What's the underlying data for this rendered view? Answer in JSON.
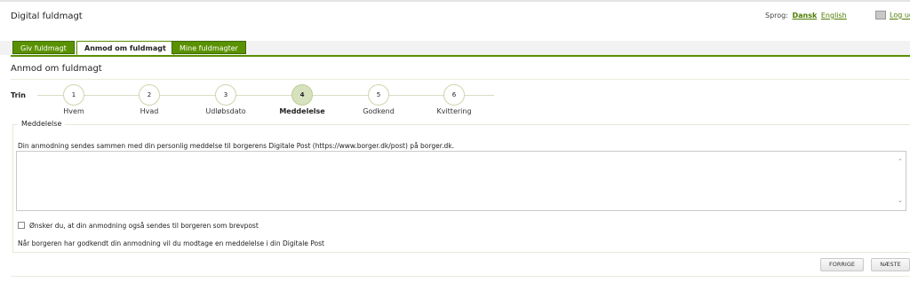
{
  "header": {
    "app_title": "Digital fuldmagt",
    "language_label": "Sprog:",
    "lang_da": "Dansk",
    "lang_en": "English",
    "logout": "Log ud"
  },
  "tabs": [
    {
      "label": "Giv fuldmagt",
      "active": false
    },
    {
      "label": "Anmod om fuldmagt",
      "active": true
    },
    {
      "label": "Mine fuldmagter",
      "active": false
    }
  ],
  "section_title": "Anmod om fuldmagt",
  "wizard": {
    "label": "Trin",
    "current": 4,
    "steps": [
      {
        "number": "1",
        "label": "Hvem"
      },
      {
        "number": "2",
        "label": "Hvad"
      },
      {
        "number": "3",
        "label": "Udløbsdato"
      },
      {
        "number": "4",
        "label": "Meddelelse"
      },
      {
        "number": "5",
        "label": "Godkend"
      },
      {
        "number": "6",
        "label": "Kvittering"
      }
    ]
  },
  "message_section": {
    "legend": "Meddelelse",
    "info": "Din anmodning sendes sammen med din personlig meddelse til borgerens Digitale Post (https://www.borger.dk/post) på borger.dk.",
    "textarea_value": "",
    "checkbox_label": "Ønsker du, at din anmodning også sendes til borgeren som brevpost",
    "checkbox_checked": false,
    "note": "Når borgeren har godkendt din anmodning vil du modtage en meddelelse i din Digitale Post"
  },
  "buttons": {
    "previous": "FORRIGE",
    "next": "NÆSTE"
  },
  "colors": {
    "accent": "#5a9100",
    "link": "#4d7c00",
    "current_step": "#d6e2bd"
  }
}
